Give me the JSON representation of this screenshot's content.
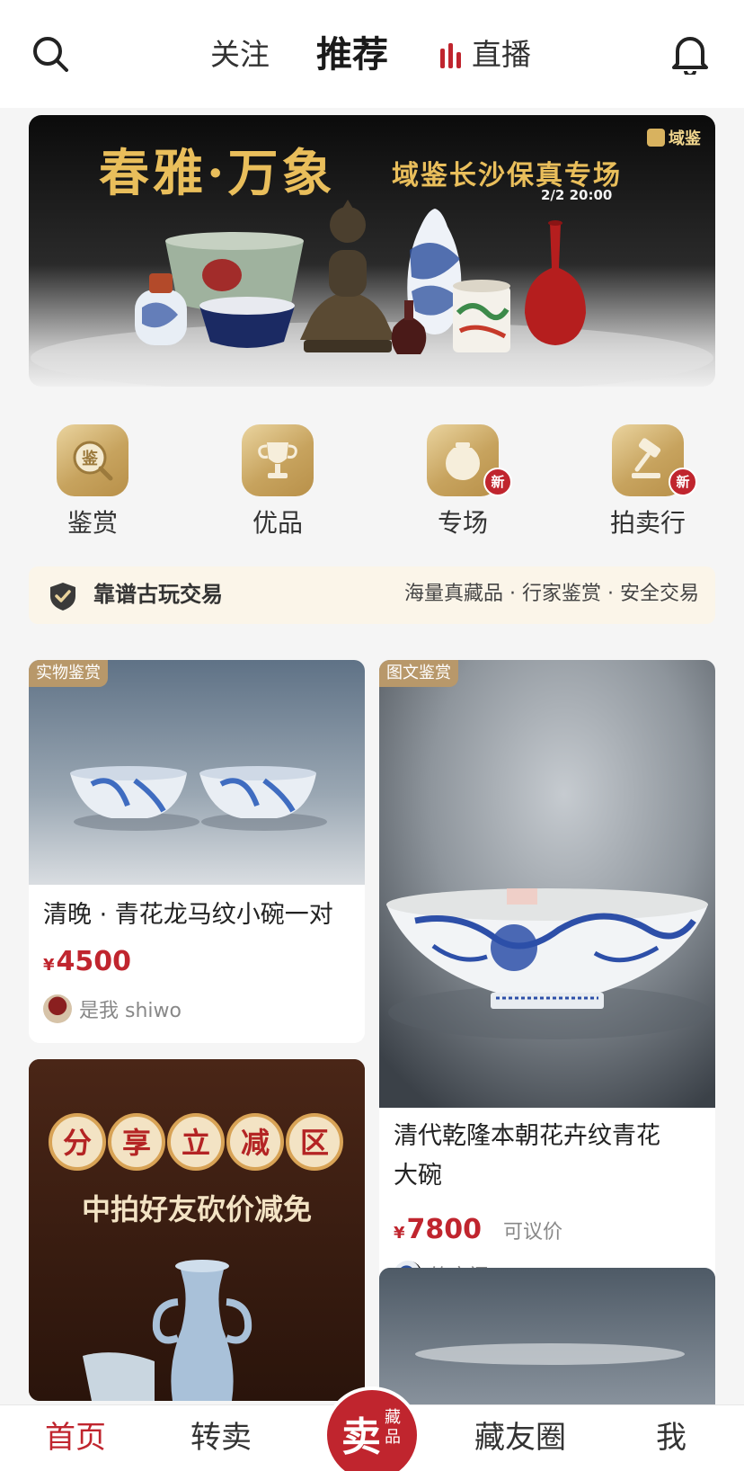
{
  "header": {
    "tabs": {
      "follow": "关注",
      "recommend": "推荐",
      "live": "直播"
    }
  },
  "banner": {
    "title": "春雅·万象",
    "subtitle": "域鉴长沙保真专场",
    "date": "2/2 20:00",
    "brand": "域鉴"
  },
  "features": [
    {
      "label": "鉴赏",
      "icon_text": "鉴",
      "icon": "magnifier-appraisal-icon"
    },
    {
      "label": "优品",
      "icon": "trophy-icon"
    },
    {
      "label": "专场",
      "icon": "jar-icon",
      "badge": "新"
    },
    {
      "label": "拍卖行",
      "icon": "gavel-icon",
      "badge": "新"
    }
  ],
  "trust": {
    "left": "靠谱古玩交易",
    "right": "海量真藏品 · 行家鉴赏 · 安全交易"
  },
  "cards": [
    {
      "tag": "实物鉴赏",
      "title": "清晚 · 青花龙马纹小碗一对",
      "currency": "¥",
      "price": "4500",
      "user": "是我 shiwo"
    },
    {
      "tag": "图文鉴赏",
      "title_line1": "清代乾隆本朝花卉纹青花",
      "title_line2": "大碗",
      "currency": "¥",
      "price": "7800",
      "negotiable": "可议价",
      "user": "竹音阁"
    },
    {
      "promo_line1": [
        "分",
        "享",
        "立",
        "减",
        "区"
      ],
      "promo_line2": "中拍好友砍价减免"
    }
  ],
  "tabbar": {
    "home": "首页",
    "resell": "转卖",
    "sell_main": "卖",
    "sell_sub": "藏品",
    "circle": "藏友圈",
    "me": "我"
  },
  "colors": {
    "accent": "#c0252e",
    "gold": "#c7a35e",
    "tag": "#b8986a"
  }
}
